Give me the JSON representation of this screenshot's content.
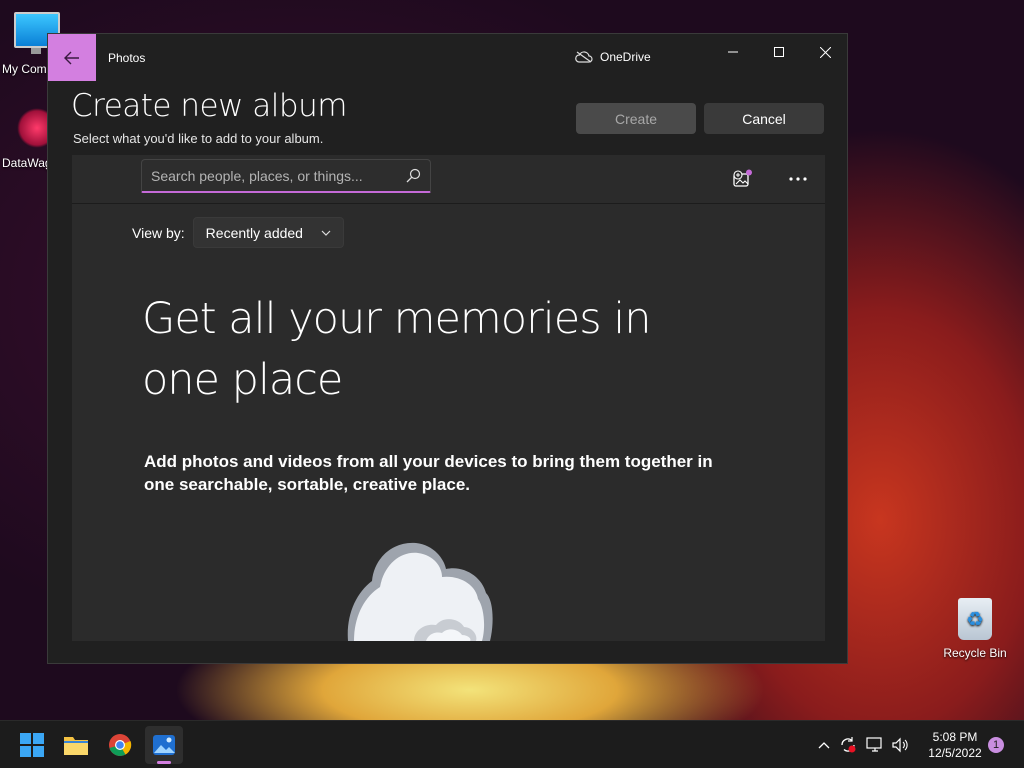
{
  "desktop": {
    "icons": [
      {
        "label": "My Com"
      },
      {
        "label": "DataWag"
      },
      {
        "label": "Recycle Bin"
      }
    ]
  },
  "window": {
    "app_title": "Photos",
    "onedrive_label": "OneDrive",
    "page_title": "Create new album",
    "page_subtitle": "Select what you'd like to add to your album.",
    "create_label": "Create",
    "cancel_label": "Cancel",
    "search": {
      "placeholder": "Search people, places, or things...",
      "value": ""
    },
    "view_by": {
      "label": "View by:",
      "selected": "Recently added"
    },
    "hero_title": "Get all your memories in one place",
    "hero_subtitle": "Add photos and videos from all your devices to bring them together in one searchable, sortable, creative place."
  },
  "taskbar": {
    "clock_time": "5:08 PM",
    "clock_date": "12/5/2022",
    "notification_count": "1"
  },
  "colors": {
    "accent": "#d37fe0",
    "window_bg": "#202020",
    "panel_bg": "#2b2b2b",
    "taskbar_bg": "#1c1c1c"
  },
  "icons": [
    "monitor-icon",
    "datawag-icon",
    "recycle-bin-icon",
    "back-arrow-icon",
    "cloud-off-icon",
    "minimize-icon",
    "maximize-icon",
    "close-icon",
    "search-icon",
    "import-icon",
    "more-icon",
    "chevron-down-icon",
    "cloud-illustration",
    "windows-start-icon",
    "file-explorer-icon",
    "chrome-icon",
    "photos-icon",
    "chevron-up-icon",
    "sync-icon",
    "network-icon",
    "volume-icon"
  ]
}
